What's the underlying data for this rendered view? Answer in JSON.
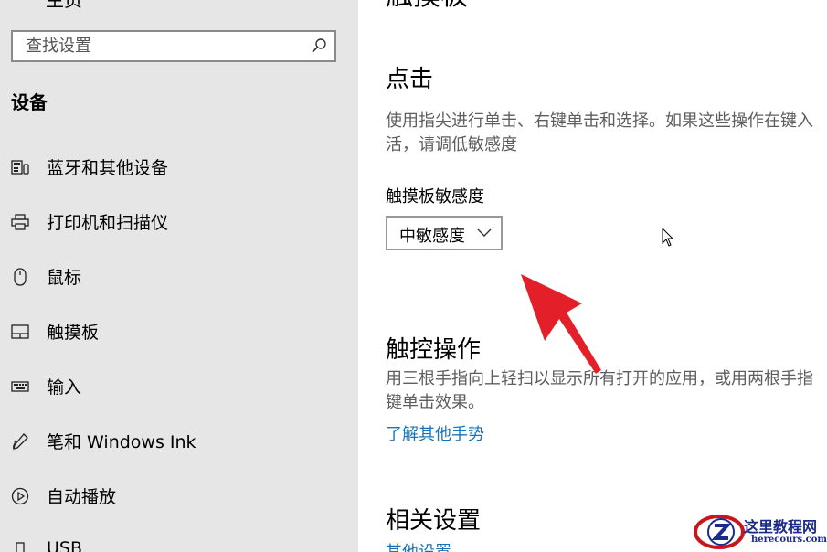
{
  "sidebar": {
    "top_cut_label": "主页",
    "search": {
      "placeholder": "查找设置"
    },
    "section_title": "设备",
    "items": [
      {
        "label": "蓝牙和其他设备",
        "icon": "bluetooth-devices-icon"
      },
      {
        "label": "打印机和扫描仪",
        "icon": "printer-icon"
      },
      {
        "label": "鼠标",
        "icon": "mouse-icon"
      },
      {
        "label": "触摸板",
        "icon": "touchpad-icon"
      },
      {
        "label": "输入",
        "icon": "keyboard-icon"
      },
      {
        "label": "笔和 Windows Ink",
        "icon": "pen-icon"
      },
      {
        "label": "自动播放",
        "icon": "autoplay-icon"
      },
      {
        "label": "USB",
        "icon": "usb-icon"
      }
    ]
  },
  "main": {
    "page_title": "触摸板",
    "taps": {
      "heading": "点击",
      "description": "使用指尖进行单击、右键单击和选择。如果这些操作在键入\n活，请调低敏感度",
      "sensitivity_label": "触摸板敏感度",
      "sensitivity_value": "中敏感度"
    },
    "touch_gestures": {
      "heading": "触控操作",
      "description": "用三根手指向上轻扫以显示所有打开的应用，或用两根手指\n键单击效果。",
      "link": "了解其他手势"
    },
    "related": {
      "heading": "相关设置",
      "link": "其他设置"
    }
  },
  "watermark": {
    "title": "这里教程网",
    "domain": "herecours.com"
  },
  "colors": {
    "sidebar_bg": "#e6e6e6",
    "link": "#1a73b8",
    "arrow": "#e3202a"
  }
}
